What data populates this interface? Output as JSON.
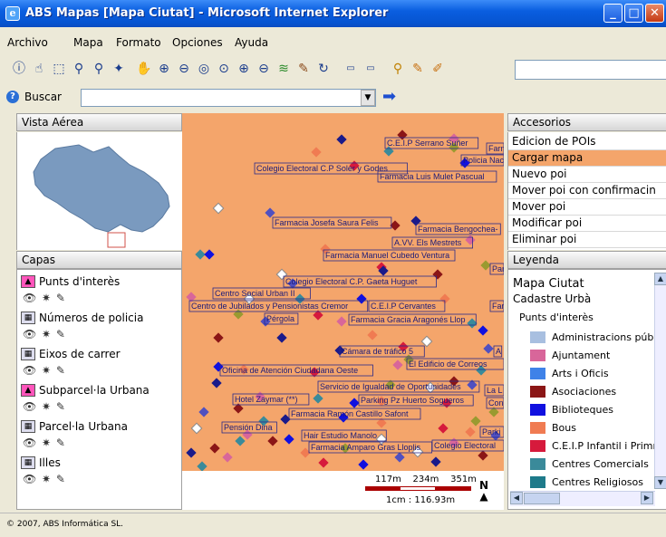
{
  "window": {
    "title": "ABS Mapas [Mapa Ciutat] - Microsoft Internet Explorer"
  },
  "menu": [
    "Archivo",
    "Mapa",
    "Formato",
    "Opciones",
    "Ayuda"
  ],
  "toolbar_icons": [
    "info-icon",
    "hand-pointer-icon",
    "select-rectangle-icon",
    "zoom-query-icon",
    "zoom-query-alt-icon",
    "highlight-select-icon",
    "pan-hand-icon",
    "zoom-in-icon",
    "zoom-out-icon",
    "zoom-extent-icon",
    "zoom-window-icon",
    "zoom-plus-icon",
    "zoom-minus-icon",
    "layers-icon",
    "edit-pen-icon",
    "refresh-icon",
    "scale-1-icon",
    "scale-2-icon",
    "pin-icon",
    "draw-line-icon",
    "measure-icon"
  ],
  "search": {
    "label": "Buscar",
    "value": ""
  },
  "vista": {
    "label": "Vista Aérea"
  },
  "capas": {
    "label": "Capas",
    "layers": [
      {
        "name": "Punts d'interès"
      },
      {
        "name": "Números de policia"
      },
      {
        "name": "Eixos de carrer"
      },
      {
        "name": "Subparcel·la Urbana"
      },
      {
        "name": "Parcel·la Urbana"
      },
      {
        "name": "Illes"
      }
    ]
  },
  "map": {
    "labels": [
      "C.E.I.P Serrano Suñer",
      "Farma",
      "Policia Nacio",
      "Colegio Electoral C.P Soler y Godes",
      "Farmacia Luis Mulet Pascual",
      "Farmacia Josefa Saura Felis",
      "Farmacia Bengochea-",
      "A.VV. Els Mestrets",
      "Farmacia Manuel Cubedo Ventura",
      "Par",
      "Colegio Electoral C.P. Gaeta Huguet",
      "Centro Social Urban II",
      "Centro de Jubilados y Pensionistas Cremor",
      "C.E.I.P Cervantes",
      "Farma",
      "Pérgola",
      "Farmacia Gracia Aragonés Llop",
      "Cámara de tráfico 5",
      "A",
      "El Edificio de Correos",
      "Oficina de Atención Ciudadana Oeste",
      "Servicio de Igualdad de Oportunidades",
      "La L",
      "Hotel Zaymar (**)",
      "Parking Pz Huerto Sogueros",
      "Conc",
      "Farmacia Ramón Castillo Safont",
      "Parki",
      "Pensión Dina",
      "Hair Estudio Manolo",
      "Colegio Electoral",
      "Farmacia Amparo Gras Lloplis"
    ],
    "scale": {
      "ticks": [
        "117m",
        "234m",
        "351m"
      ],
      "ratio": "1cm : 116.93m"
    },
    "north": "N"
  },
  "accesorios": {
    "label": "Accesorios",
    "items": [
      "Edicion de POIs",
      "Cargar mapa",
      "Nuevo poi",
      "Mover poi con confirmacin",
      "Mover poi",
      "Modificar poi",
      "Eliminar poi"
    ],
    "selected": "Cargar mapa"
  },
  "leyenda": {
    "label": "Leyenda",
    "title": "Mapa Ciutat",
    "subtitle": "Cadastre Urbà",
    "group": "Punts d'interès",
    "items": [
      {
        "label": "Administracions públiqu",
        "color": "#a8bfe0"
      },
      {
        "label": "Ajuntament",
        "color": "#d8669a"
      },
      {
        "label": "Arts i Oficis",
        "color": "#3f82e8"
      },
      {
        "label": "Asociaciones",
        "color": "#8b1616"
      },
      {
        "label": "Biblioteques",
        "color": "#1010e0"
      },
      {
        "label": "Bous",
        "color": "#f07b52"
      },
      {
        "label": "C.E.I.P Infantil i Primri",
        "color": "#d61a3c"
      },
      {
        "label": "Centres Comercials",
        "color": "#3a8a9a"
      },
      {
        "label": "Centres Religiosos",
        "color": "#1e7a8a"
      }
    ]
  },
  "status": {
    "copyright": "© 2007, ABS Informática SL."
  }
}
